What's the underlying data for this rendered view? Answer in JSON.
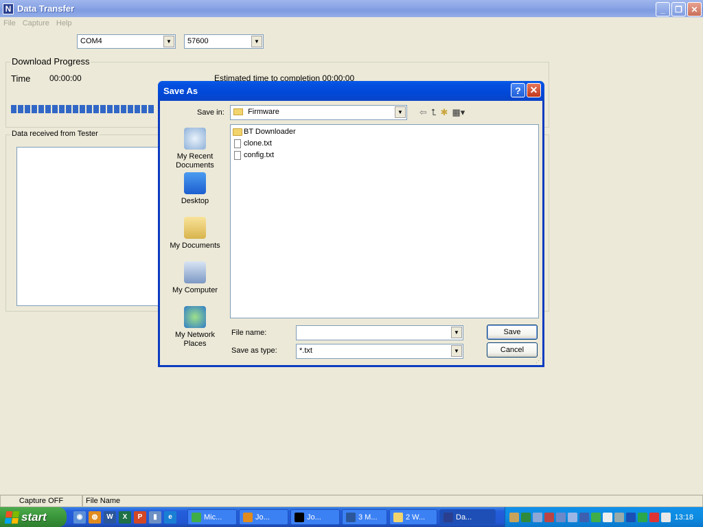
{
  "window": {
    "title": "Data Transfer",
    "icon": "app-icon"
  },
  "menu": {
    "items": [
      "File",
      "Capture",
      "Help"
    ]
  },
  "port": {
    "com_value": "COM4",
    "baud_value": "57600"
  },
  "download": {
    "legend": "Download Progress",
    "time_label": "Time",
    "time_value": "00:00:00",
    "estimate_label": "Estimated time to completion",
    "estimate_value": "00:00:00",
    "progress_fraction": 0.27
  },
  "received": {
    "legend": "Data received from Tester"
  },
  "statusbar": {
    "capture": "Capture OFF",
    "file_name": "File Name"
  },
  "dialog": {
    "title": "Save As",
    "save_in_label": "Save in:",
    "save_in_value": "Firmware",
    "places": [
      {
        "label": "My Recent Documents",
        "icon": "recent-documents-icon"
      },
      {
        "label": "Desktop",
        "icon": "desktop-icon"
      },
      {
        "label": "My Documents",
        "icon": "my-documents-icon"
      },
      {
        "label": "My Computer",
        "icon": "my-computer-icon"
      },
      {
        "label": "My Network Places",
        "icon": "network-places-icon"
      }
    ],
    "files": [
      {
        "name": "BT Downloader",
        "type": "folder"
      },
      {
        "name": "clone.txt",
        "type": "text"
      },
      {
        "name": "config.txt",
        "type": "text"
      }
    ],
    "file_name_label": "File name:",
    "file_name_value": "",
    "save_type_label": "Save as type:",
    "save_type_value": "*.txt",
    "save_button": "Save",
    "cancel_button": "Cancel"
  },
  "taskbar": {
    "start_label": "start",
    "tasks": [
      {
        "label": "Mic...",
        "active": false
      },
      {
        "label": "Jo...",
        "active": false
      },
      {
        "label": "Jo...",
        "active": false
      },
      {
        "label": "3 M...",
        "active": false
      },
      {
        "label": "2 W...",
        "active": false
      },
      {
        "label": "Da...",
        "active": true
      }
    ],
    "clock": "13:18"
  }
}
